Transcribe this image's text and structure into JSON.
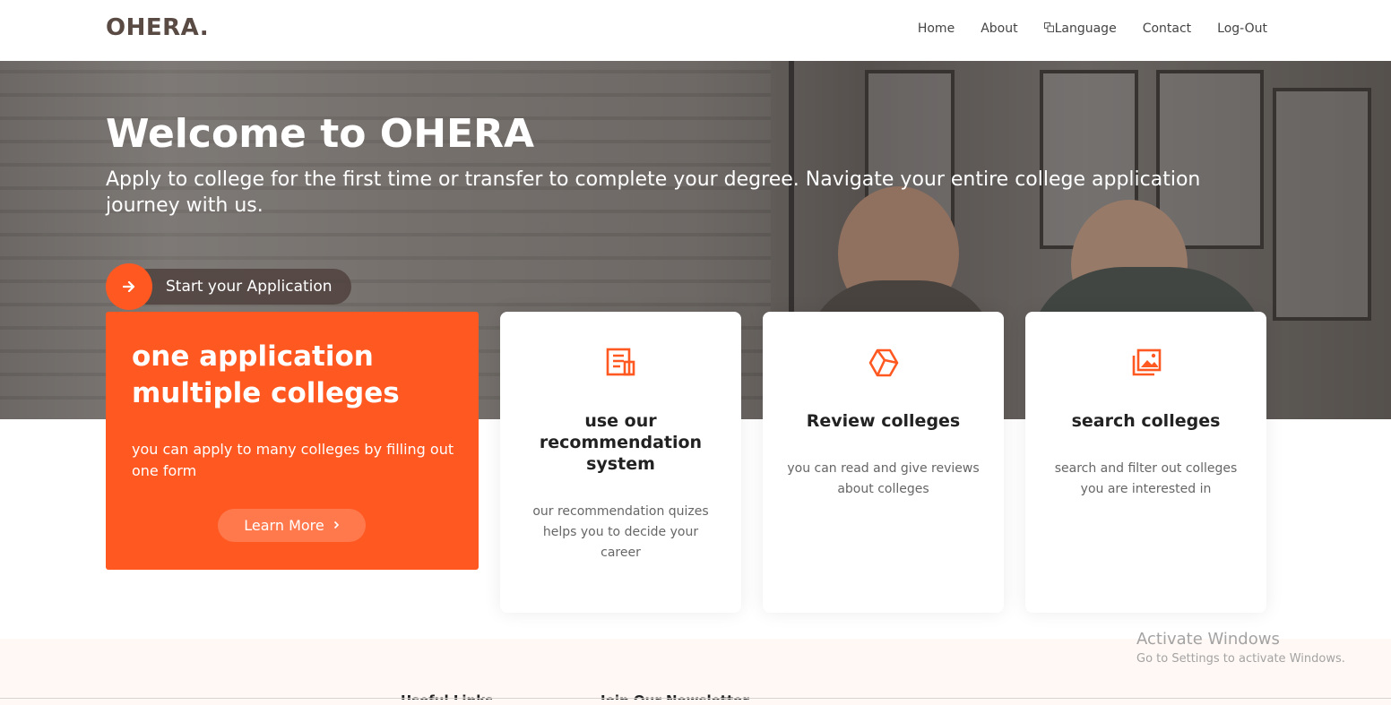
{
  "header": {
    "logo": "OHERA.",
    "nav": [
      {
        "label": "Home"
      },
      {
        "label": "About"
      },
      {
        "label": "Language",
        "icon": "translate-icon"
      },
      {
        "label": "Contact"
      },
      {
        "label": "Log-Out"
      }
    ]
  },
  "hero": {
    "title": "Welcome to OHERA",
    "subtitle": "Apply to college for the first time or transfer to complete your degree. Navigate your entire college application journey with us.",
    "cta_label": "Start your Application",
    "cta_icon": "arrow-right-icon"
  },
  "feature": {
    "title": "one application multiple colleges",
    "text": "you can apply to many colleges by filling out one form",
    "button_label": "Learn More",
    "button_icon": "chevron-right-icon"
  },
  "cards": [
    {
      "icon": "document-icon",
      "title": "use our recommendation system",
      "text": "our recommendation quizes helps you to decide your career"
    },
    {
      "icon": "cube-icon",
      "title": "Review colleges",
      "text": "you can read and give reviews about colleges"
    },
    {
      "icon": "images-icon",
      "title": "search colleges",
      "text": "search and filter out colleges you are interested in"
    }
  ],
  "footer": {
    "col2_heading": "Useful Links",
    "col3_heading": "Join Our Newsletter"
  },
  "watermark": {
    "line1": "Activate Windows",
    "line2": "Go to Settings to activate Windows."
  },
  "colors": {
    "accent": "#ff5821",
    "logo": "#5a4a44",
    "footer_bg": "#fff8f5"
  }
}
